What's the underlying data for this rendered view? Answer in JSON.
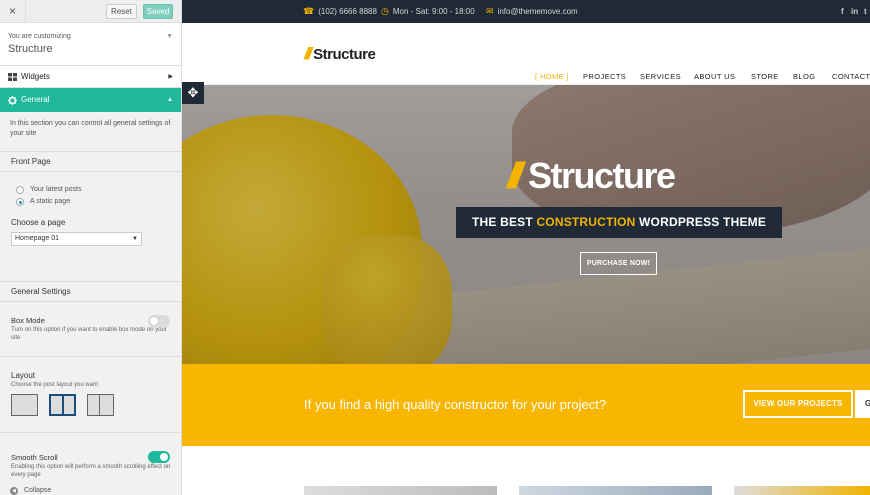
{
  "sidebar": {
    "close_label": "×",
    "reset_label": "Reset",
    "saved_label": "Saved",
    "customizing_label": "You are customizing",
    "theme_name": "Structure",
    "sections": [
      {
        "label": "Widgets",
        "icon": "widgets-icon"
      },
      {
        "label": "General",
        "icon": "gear-icon"
      }
    ],
    "general_desc": "In this section you can control all general settings of your site",
    "front_page": {
      "title": "Front Page",
      "options": [
        "Your latest posts",
        "A static page"
      ],
      "selected_option": "A static page",
      "choose_label": "Choose a page",
      "page_value": "Homepage 01"
    },
    "general_settings_title": "General Settings",
    "box_mode": {
      "title": "Box Mode",
      "desc": "Turn on this option if you want to enable box mode on your site",
      "enabled": false
    },
    "layout": {
      "title": "Layout",
      "desc": "Choose the post layout you want",
      "options": [
        "full-width",
        "two-columns",
        "sidebar"
      ],
      "selected": "two-columns"
    },
    "smooth_scroll": {
      "title": "Smooth Scroll",
      "desc": "Enabling this option will perform a smooth scrolling effect on every page",
      "enabled": true
    },
    "collapse_label": "Collapse"
  },
  "preview": {
    "topbar": {
      "phone": "(102) 6666 8888",
      "hours": "Mon - Sat: 9:00 - 18:00",
      "email": "info@thememove.com",
      "social": [
        "f",
        "in",
        "t"
      ]
    },
    "logo_text": "Structure",
    "menu": [
      "[ HOME ]",
      "PROJECTS",
      "SERVICES",
      "ABOUT US",
      "STORE",
      "BLOG",
      "CONTACT"
    ],
    "active_menu": "[ HOME ]",
    "hero": {
      "logo_text": "Structure",
      "tagline_pre": "THE BEST ",
      "tagline_highlight": "CONSTRUCTION",
      "tagline_post": " WORDPRESS THEME",
      "button_label": "PURCHASE NOW!"
    },
    "cta": {
      "text": "If you find a high quality constructor for your project?",
      "button_label": "VIEW OUR PROJECTS",
      "button2_label": "G"
    }
  },
  "colors": {
    "accent_yellow": "#f8b600",
    "dark_navy": "#1f2a36",
    "customizer_green": "#1fb89a"
  }
}
